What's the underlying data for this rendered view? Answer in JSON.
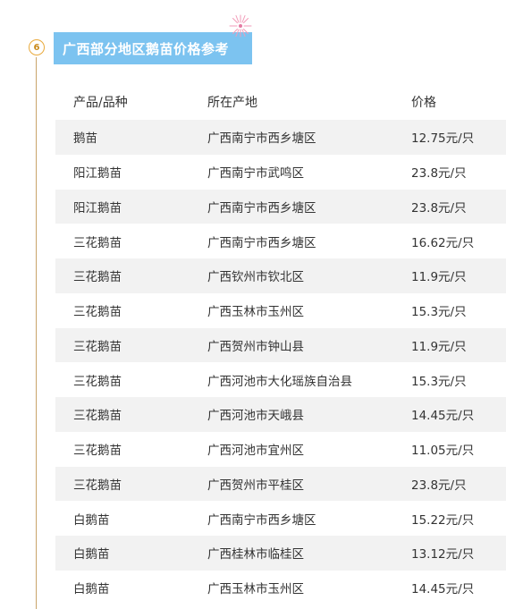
{
  "step": {
    "number": "6"
  },
  "title": "广西部分地区鹅苗价格参考",
  "colors": {
    "banner": "#7cc3f0",
    "badge": "#e9a93a",
    "row_shade": "#f2f2f2"
  },
  "table": {
    "headers": {
      "product": "产品/品种",
      "origin": "所在产地",
      "price": "价格"
    },
    "rows": [
      {
        "product": "鹅苗",
        "origin": "广西南宁市西乡塘区",
        "price": "12.75元/只"
      },
      {
        "product": "阳江鹅苗",
        "origin": "广西南宁市武鸣区",
        "price": "23.8元/只"
      },
      {
        "product": "阳江鹅苗",
        "origin": "广西南宁市西乡塘区",
        "price": "23.8元/只"
      },
      {
        "product": "三花鹅苗",
        "origin": "广西南宁市西乡塘区",
        "price": "16.62元/只"
      },
      {
        "product": "三花鹅苗",
        "origin": "广西钦州市钦北区",
        "price": "11.9元/只"
      },
      {
        "product": "三花鹅苗",
        "origin": "广西玉林市玉州区",
        "price": "15.3元/只"
      },
      {
        "product": "三花鹅苗",
        "origin": "广西贺州市钟山县",
        "price": "11.9元/只"
      },
      {
        "product": "三花鹅苗",
        "origin": "广西河池市大化瑶族自治县",
        "price": "15.3元/只"
      },
      {
        "product": "三花鹅苗",
        "origin": "广西河池市天峨县",
        "price": "14.45元/只"
      },
      {
        "product": "三花鹅苗",
        "origin": "广西河池市宜州区",
        "price": "11.05元/只"
      },
      {
        "product": "三花鹅苗",
        "origin": "广西贺州市平桂区",
        "price": "23.8元/只"
      },
      {
        "product": "白鹅苗",
        "origin": "广西南宁市西乡塘区",
        "price": "15.22元/只"
      },
      {
        "product": "白鹅苗",
        "origin": "广西桂林市临桂区",
        "price": "13.12元/只"
      },
      {
        "product": "白鹅苗",
        "origin": "广西玉林市玉州区",
        "price": "14.45元/只"
      }
    ]
  }
}
